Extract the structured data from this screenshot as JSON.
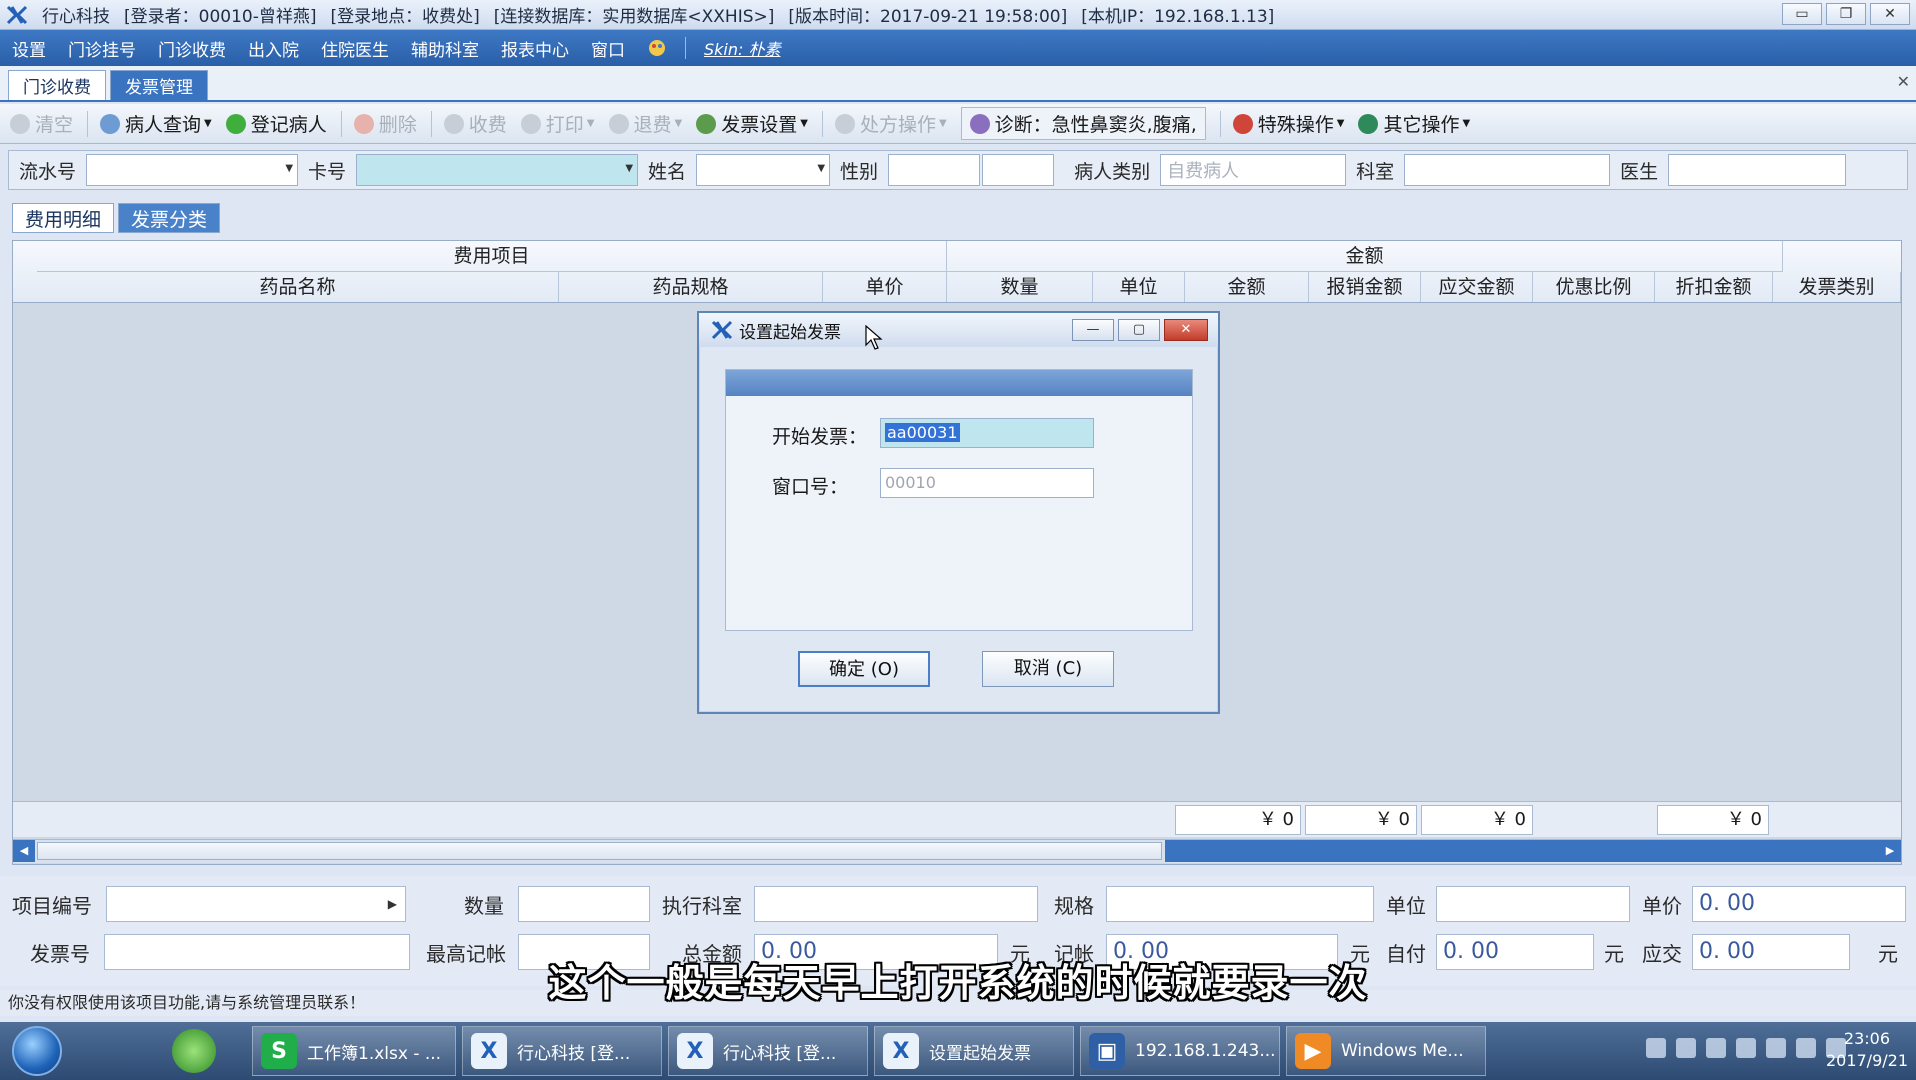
{
  "window": {
    "title_segments": [
      "行心科技",
      "[登录者：00010-曾祥燕]",
      "[登录地点：收费处]",
      "[连接数据库：实用数据库<XXHIS>]",
      "[版本时间：2017-09-21 19:58:00]",
      "[本机IP：192.168.1.13]"
    ],
    "controls": [
      "▭",
      "❐",
      "✕"
    ]
  },
  "menu": {
    "items": [
      "设置",
      "门诊挂号",
      "门诊收费",
      "出入院",
      "住院医生",
      "辅助科室",
      "报表中心",
      "窗口"
    ],
    "skin": "Skin: 朴素"
  },
  "doc_tabs": [
    "门诊收费",
    "发票管理"
  ],
  "toolbar": {
    "clear": "清空",
    "patient_query": "病人查询",
    "register_patient": "登记病人",
    "delete": "删除",
    "charge": "收费",
    "print": "打印",
    "refund": "退费",
    "invoice_settings": "发票设置",
    "prescription_ops": "处方操作",
    "diagnosis": "诊断：急性鼻窦炎,腹痛,",
    "special_ops": "特殊操作",
    "other_ops": "其它操作"
  },
  "form": {
    "serial_label": "流水号",
    "card_label": "卡号",
    "name_label": "姓名",
    "gender_label": "性别",
    "patient_type_label": "病人类别",
    "patient_type_value": "自费病人",
    "dept_label": "科室",
    "doctor_label": "医生"
  },
  "sub_tabs": [
    "费用明细",
    "发票分类"
  ],
  "grid": {
    "group_item": "费用项目",
    "group_amount": "金额",
    "columns": [
      "药品名称",
      "药品规格",
      "单价",
      "数量",
      "单位",
      "金额",
      "报销金额",
      "应交金额",
      "优惠比例",
      "折扣金额",
      "发票类别"
    ],
    "totals": [
      "￥ 0",
      "￥ 0",
      "￥ 0",
      "￥ 0"
    ]
  },
  "bottom": {
    "item_code_label": "项目编号",
    "qty_label": "数量",
    "exec_dept_label": "执行科室",
    "spec_label": "规格",
    "unit_label": "单位",
    "unit_price_label": "单价",
    "unit_price_value": "0. 00",
    "invoice_no_label": "发票号",
    "max_credit_label": "最高记帐",
    "total_label": "总金额",
    "total_value": "0. 00",
    "yuan1": "元",
    "credit_label": "记帐",
    "credit_value": "0. 00",
    "yuan2": "元",
    "self_pay_label": "自付",
    "self_pay_value": "0. 00",
    "yuan3": "元",
    "due_label": "应交",
    "due_value": "0. 00",
    "yuan4": "元"
  },
  "status_text": "你没有权限使用该项目功能,请与系统管理员联系！",
  "subtitle": "这个一般是每天早上打开系统的时候就要录一次",
  "dialog": {
    "title": "设置起始发票",
    "start_invoice_label": "开始发票：",
    "start_invoice_value": "aa00031",
    "window_no_label": "窗口号：",
    "window_no_value": "00010",
    "ok_label": "确定 (O)",
    "cancel_label": "取消 (C)"
  },
  "taskbar": {
    "tasks": [
      "工作簿1.xlsx - ...",
      "行心科技 [登...",
      "行心科技 [登...",
      "设置起始发票",
      "192.168.1.243...",
      "Windows Me..."
    ],
    "time": "23:06",
    "date": "2017/9/21"
  },
  "colors": {
    "accent": "#3a73c0",
    "menu_bg": "#2a5fa8",
    "selection": "#3372d6",
    "input_highlight": "#bfe5ef"
  }
}
